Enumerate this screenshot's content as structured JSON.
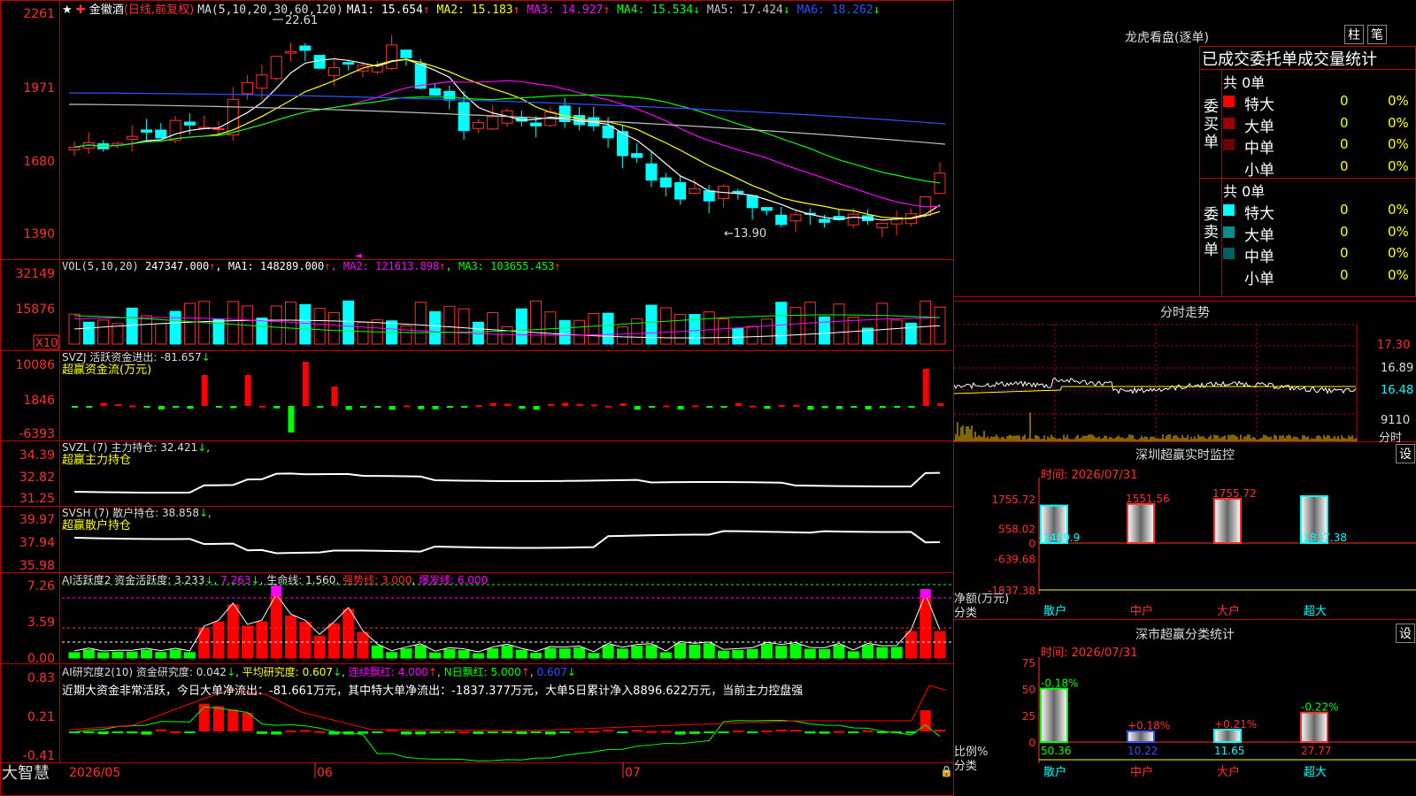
{
  "stock": {
    "name": "金徽酒",
    "period": "(日线,前复权)",
    "brand": "大智慧"
  },
  "main": {
    "ma_label": "MA(5,10,20,30,60,120)",
    "ma_items": [
      {
        "name": "MA1:",
        "value": "15.654",
        "arrow": "↑",
        "color": "#ffffff"
      },
      {
        "name": "MA2:",
        "value": "15.183",
        "arrow": "↑",
        "color": "#ffff00"
      },
      {
        "name": "MA3:",
        "value": "14.927",
        "arrow": "↑",
        "color": "#ff00ff"
      },
      {
        "name": "MA4:",
        "value": "15.534",
        "arrow": "↓",
        "color": "#00ff00"
      },
      {
        "name": "MA5:",
        "value": "17.424",
        "arrow": "↓",
        "color": "#c0c0c0"
      },
      {
        "name": "MA6:",
        "value": "18.262",
        "arrow": "↓",
        "color": "#3050ff"
      }
    ],
    "y_ticks": [
      "2261",
      "1971",
      "1680",
      "1390"
    ],
    "high_label": "22.61",
    "low_label": "←13.90"
  },
  "vol": {
    "label": "VOL(5,10,20)",
    "value": "247347.000",
    "arrow": "↑",
    "items": [
      {
        "name": "MA1:",
        "value": "148289.000",
        "arrow": "↑",
        "color": "#ffffff"
      },
      {
        "name": "MA2:",
        "value": "121613.898",
        "arrow": "↑",
        "color": "#ff00ff"
      },
      {
        "name": "MA3:",
        "value": "103655.453",
        "arrow": "↑",
        "color": "#00ff00"
      }
    ],
    "y_ticks": [
      "32149",
      "15876"
    ],
    "unit": "X10"
  },
  "svzj": {
    "label": "SVZJ  活跃资金进出:",
    "value": "-81.657",
    "arrow": "↓",
    "sub": "超赢资金流(万元)",
    "y_ticks": [
      "10086",
      "1846",
      "-6393"
    ]
  },
  "svzl": {
    "label": "SVZL (7) 主力持仓:",
    "value": "32.421",
    "arrow": "↓",
    "sub": "超赢主力持仓",
    "y_ticks": [
      "34.39",
      "32.82",
      "31.25"
    ]
  },
  "svsh": {
    "label": "SVSH (7) 散户持仓:",
    "value": "38.858",
    "arrow": "↓",
    "sub": "超赢散户持仓",
    "y_ticks": [
      "39.97",
      "37.94",
      "35.98"
    ]
  },
  "ai1": {
    "label": "AI活跃度2 资金活跃度:",
    "v1": "3.233",
    "a1": "↓",
    "v2": "7.263",
    "a2": "↓",
    "l3": "生命线:",
    "v3": "1.560",
    "l4": "强势线:",
    "v4": "3.000",
    "l5": "爆发线:",
    "v5": "6.000",
    "y_ticks": [
      "7.26",
      "3.59",
      "0.00"
    ]
  },
  "ai2": {
    "label": "AI研究度2(10) 资金研究度:",
    "v1": "0.042",
    "a1": "↓",
    "l2": "平均研究度:",
    "v2": "0.607",
    "a2": "↓",
    "l3": "连续飘红:",
    "v3": "4.000",
    "a3": "↑",
    "l4": "N日飘红:",
    "v4": "5.000",
    "a4": "↑",
    "v5": "0.607",
    "a5": "↓",
    "summary": "近期大资金非常活跃，今日大单净流出：-81.661万元，其中特大单净流出：-1837.377万元，大单5日累计净入8896.622万元，当前主力控盘强",
    "y_ticks": [
      "0.83",
      "0.21",
      "-0.41"
    ]
  },
  "x_axis": [
    "2026/05",
    "06",
    "07"
  ],
  "right": {
    "lhb": {
      "title": "龙虎看盘(逐单)",
      "btn1": "柱",
      "btn2": "笔",
      "header": "已成交委托单成交量统计",
      "buy": {
        "side": "委买单",
        "total": "共 0单",
        "rows": [
          {
            "label": "特大",
            "count": "0",
            "pct": "0%",
            "color": "#ff0000"
          },
          {
            "label": "大单",
            "count": "0",
            "pct": "0%",
            "color": "#a00000"
          },
          {
            "label": "中单",
            "count": "0",
            "pct": "0%",
            "color": "#700000"
          },
          {
            "label": "小单",
            "count": "0",
            "pct": "0%",
            "color": "#000000"
          }
        ]
      },
      "sell": {
        "side": "委卖单",
        "total": "共 0单",
        "rows": [
          {
            "label": "特大",
            "count": "0",
            "pct": "0%",
            "color": "#00ffff"
          },
          {
            "label": "大单",
            "count": "0",
            "pct": "0%",
            "color": "#009090"
          },
          {
            "label": "中单",
            "count": "0",
            "pct": "0%",
            "color": "#006060"
          },
          {
            "label": "小单",
            "count": "0",
            "pct": "0%",
            "color": "#000000"
          }
        ]
      }
    },
    "intraday": {
      "title": "分时走势",
      "prices": [
        "17.30",
        "16.89",
        "16.48"
      ],
      "vol": "9110",
      "vol_label": "分时"
    },
    "monitor": {
      "title": "深圳超赢实时监控",
      "btn": "设",
      "time": "时间: 2026/07/31",
      "y_ticks": [
        "1755.72",
        "558.02",
        "0",
        "-639.68",
        "-1837.38"
      ],
      "ylabel": "净额(万元)",
      "xlabel": "分类",
      "bars": [
        {
          "cat": "散户",
          "value": "-1469.9"
        },
        {
          "cat": "中户",
          "value": "1551.56"
        },
        {
          "cat": "大户",
          "value": "1755.72"
        },
        {
          "cat": "超大",
          "value": "-1837.38"
        }
      ]
    },
    "stats": {
      "title": "深市超赢分类统计",
      "btn": "设",
      "time": "时间: 2026/07/31",
      "y_ticks": [
        "75",
        "50",
        "25",
        "0"
      ],
      "ylabel": "比例%",
      "xlabel": "分类",
      "bars": [
        {
          "cat": "散户",
          "value": "50.36",
          "change": "-0.18%"
        },
        {
          "cat": "中户",
          "value": "10.22",
          "change": "+0.18%"
        },
        {
          "cat": "大户",
          "value": "11.65",
          "change": "+0.21%"
        },
        {
          "cat": "超大",
          "value": "27.77",
          "change": "-0.22%"
        }
      ]
    }
  }
}
